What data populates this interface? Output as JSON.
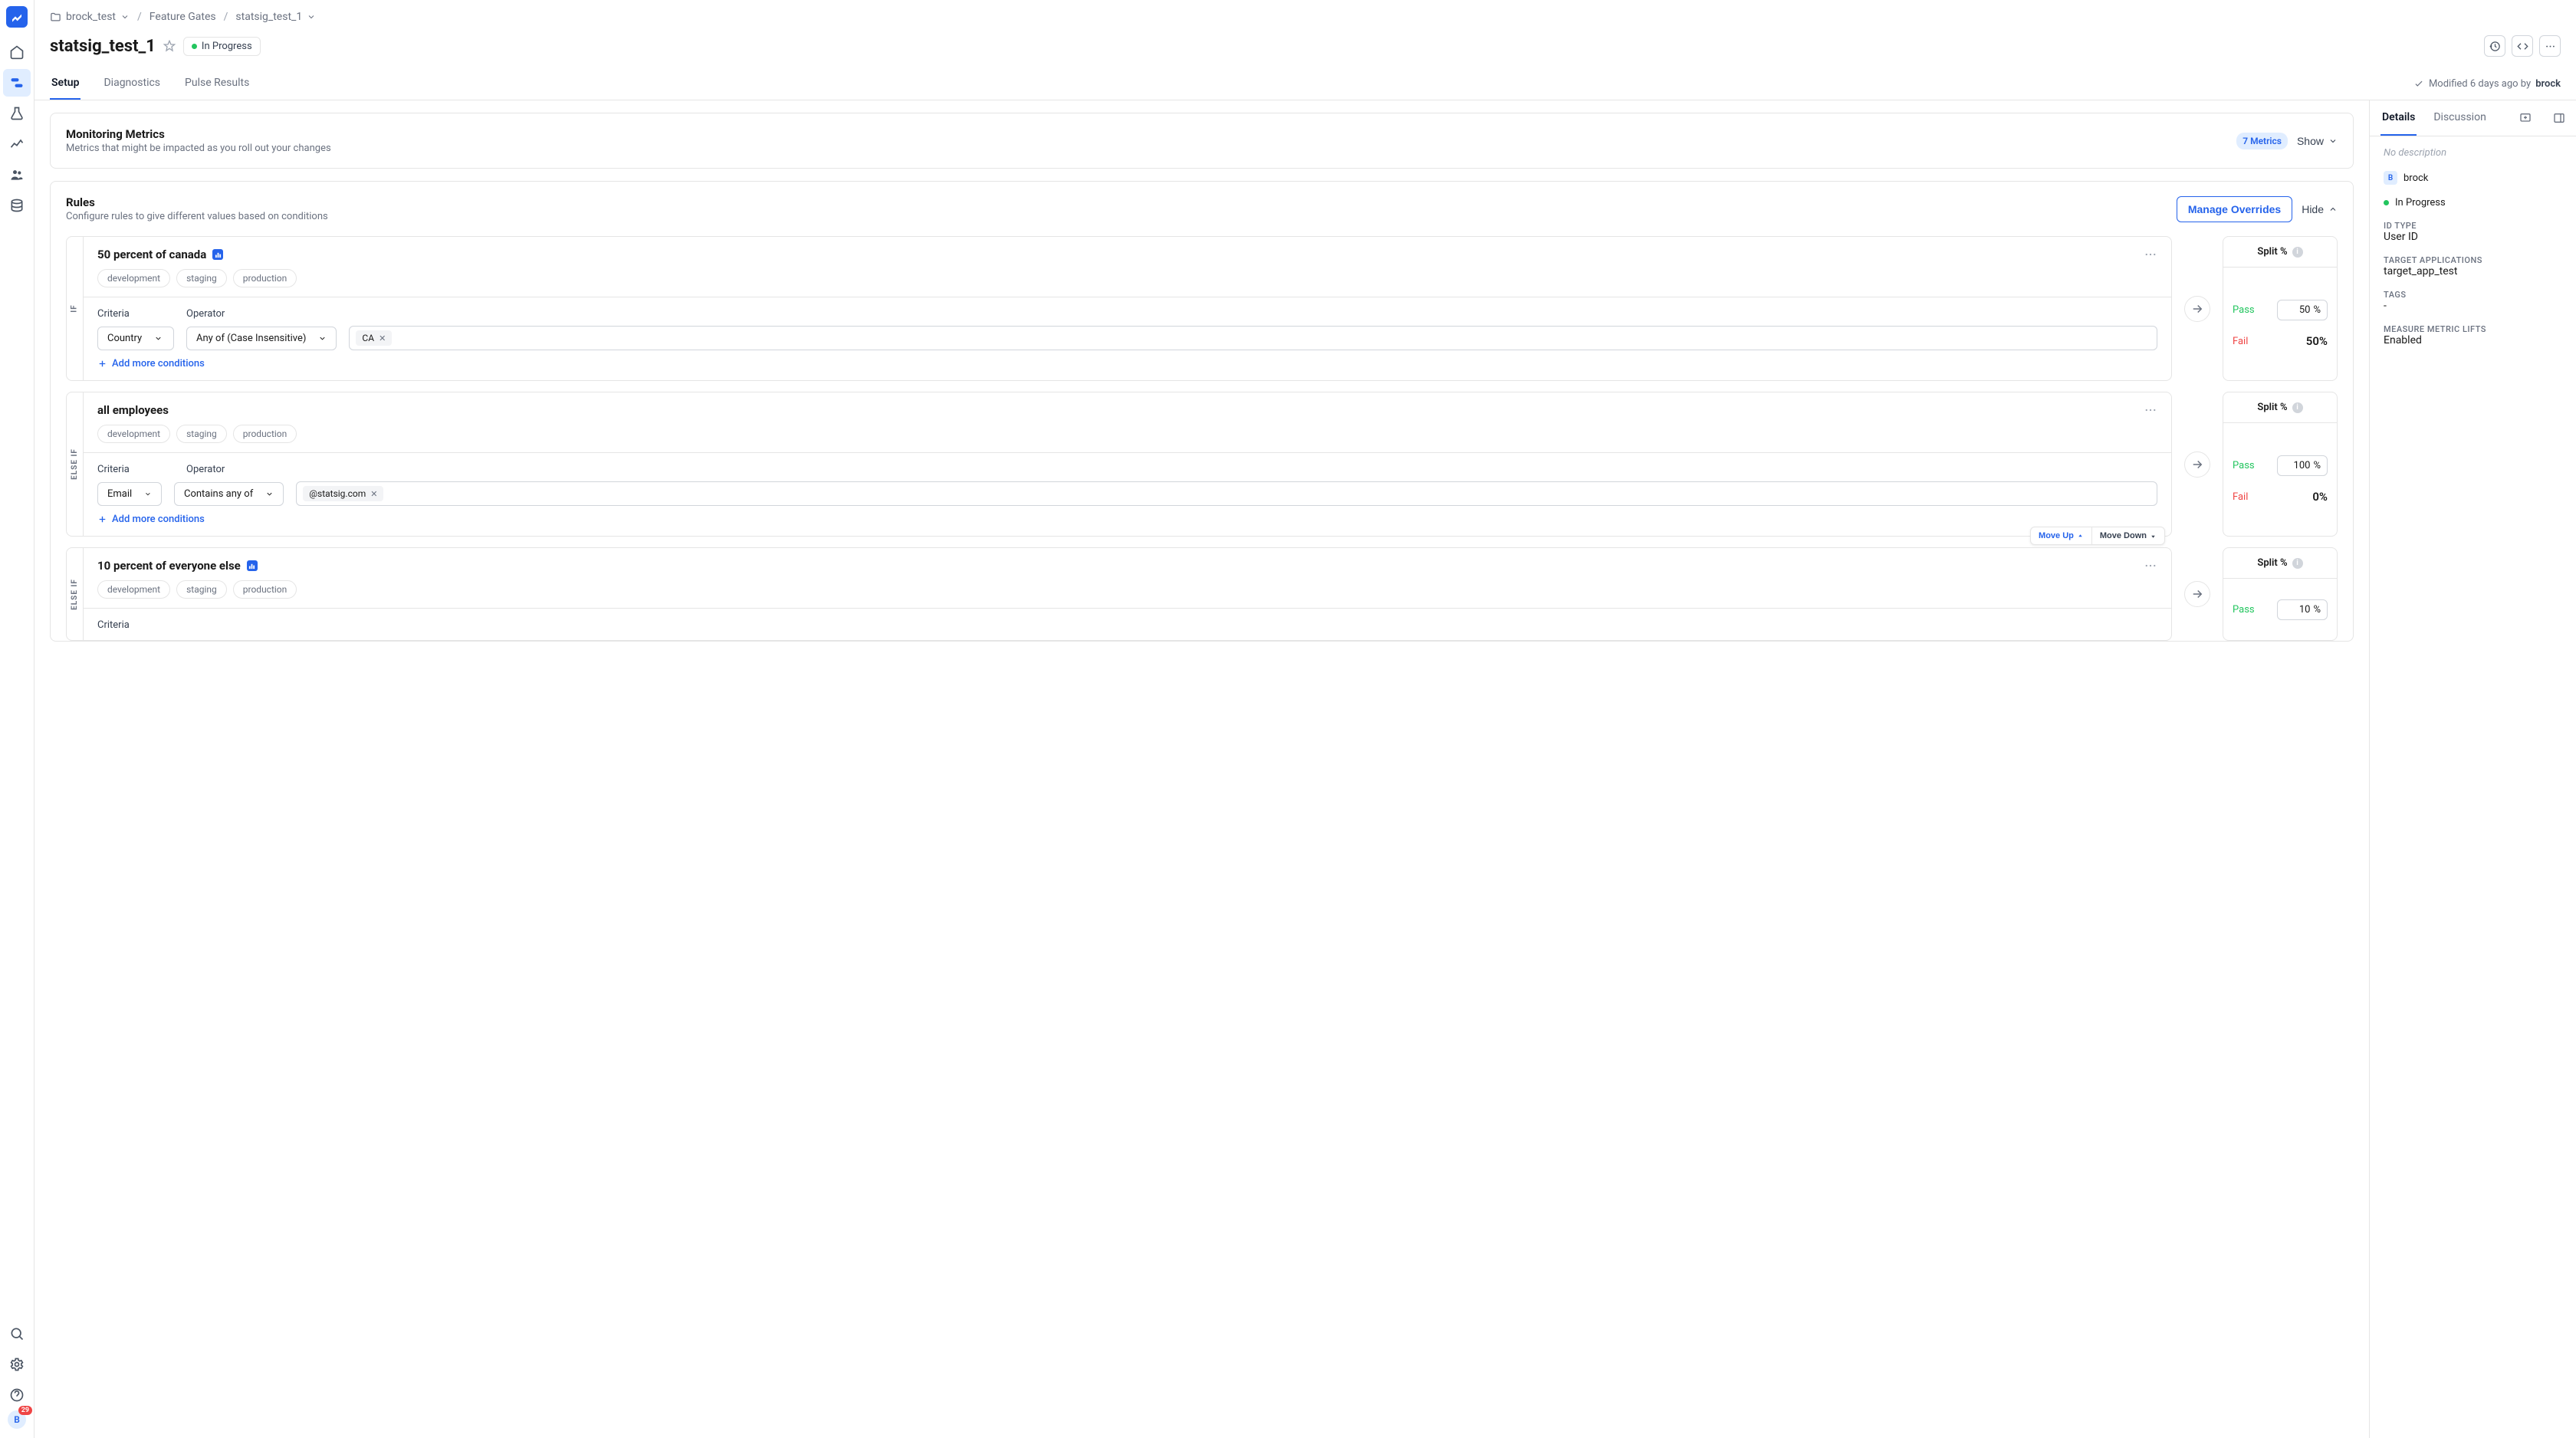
{
  "breadcrumb": {
    "folder": "brock_test",
    "section": "Feature Gates",
    "item": "statsig_test_1"
  },
  "page": {
    "title": "statsig_test_1",
    "status": "In Progress"
  },
  "tabs": {
    "setup": "Setup",
    "diagnostics": "Diagnostics",
    "pulse": "Pulse Results"
  },
  "modified": {
    "prefix": "Modified 6 days ago by",
    "author": "brock"
  },
  "metrics_card": {
    "title": "Monitoring Metrics",
    "subtitle": "Metrics that might be impacted as you roll out your changes",
    "badge": "7 Metrics",
    "toggle": "Show"
  },
  "rules_card": {
    "title": "Rules",
    "subtitle": "Configure rules to give different values based on conditions",
    "manage_btn": "Manage Overrides",
    "toggle": "Hide"
  },
  "env_tags": [
    "development",
    "staging",
    "production"
  ],
  "labels": {
    "criteria": "Criteria",
    "operator": "Operator",
    "add_cond": "Add more conditions",
    "split": "Split %",
    "pass": "Pass",
    "fail": "Fail",
    "pct": "%",
    "if": "IF",
    "elseif": "ELSE IF",
    "move_up": "Move Up",
    "move_down": "Move Down"
  },
  "rules": [
    {
      "name": "50 percent of canada",
      "has_chart": true,
      "label": "IF",
      "criteria": "Country",
      "operator": "Any of (Case Insensitive)",
      "chips": [
        "CA"
      ],
      "pass": "50",
      "fail": "50%",
      "show_move": false
    },
    {
      "name": "all employees",
      "has_chart": false,
      "label": "ELSE IF",
      "criteria": "Email",
      "operator": "Contains any of",
      "chips": [
        "@statsig.com"
      ],
      "pass": "100",
      "fail": "0%",
      "show_move": true
    },
    {
      "name": "10 percent of everyone else",
      "has_chart": true,
      "label": "ELSE IF",
      "criteria": "",
      "operator": "",
      "chips": [],
      "pass": "10",
      "fail": "",
      "show_move": false
    }
  ],
  "details": {
    "tab_details": "Details",
    "tab_discussion": "Discussion",
    "no_desc": "No description",
    "author": "brock",
    "status": "In Progress",
    "id_type_label": "ID TYPE",
    "id_type": "User ID",
    "target_apps_label": "TARGET APPLICATIONS",
    "target_apps": "target_app_test",
    "tags_label": "TAGS",
    "tags": "-",
    "measure_label": "MEASURE METRIC LIFTS",
    "measure": "Enabled"
  },
  "avatar": {
    "initial": "B",
    "badge": "29"
  }
}
